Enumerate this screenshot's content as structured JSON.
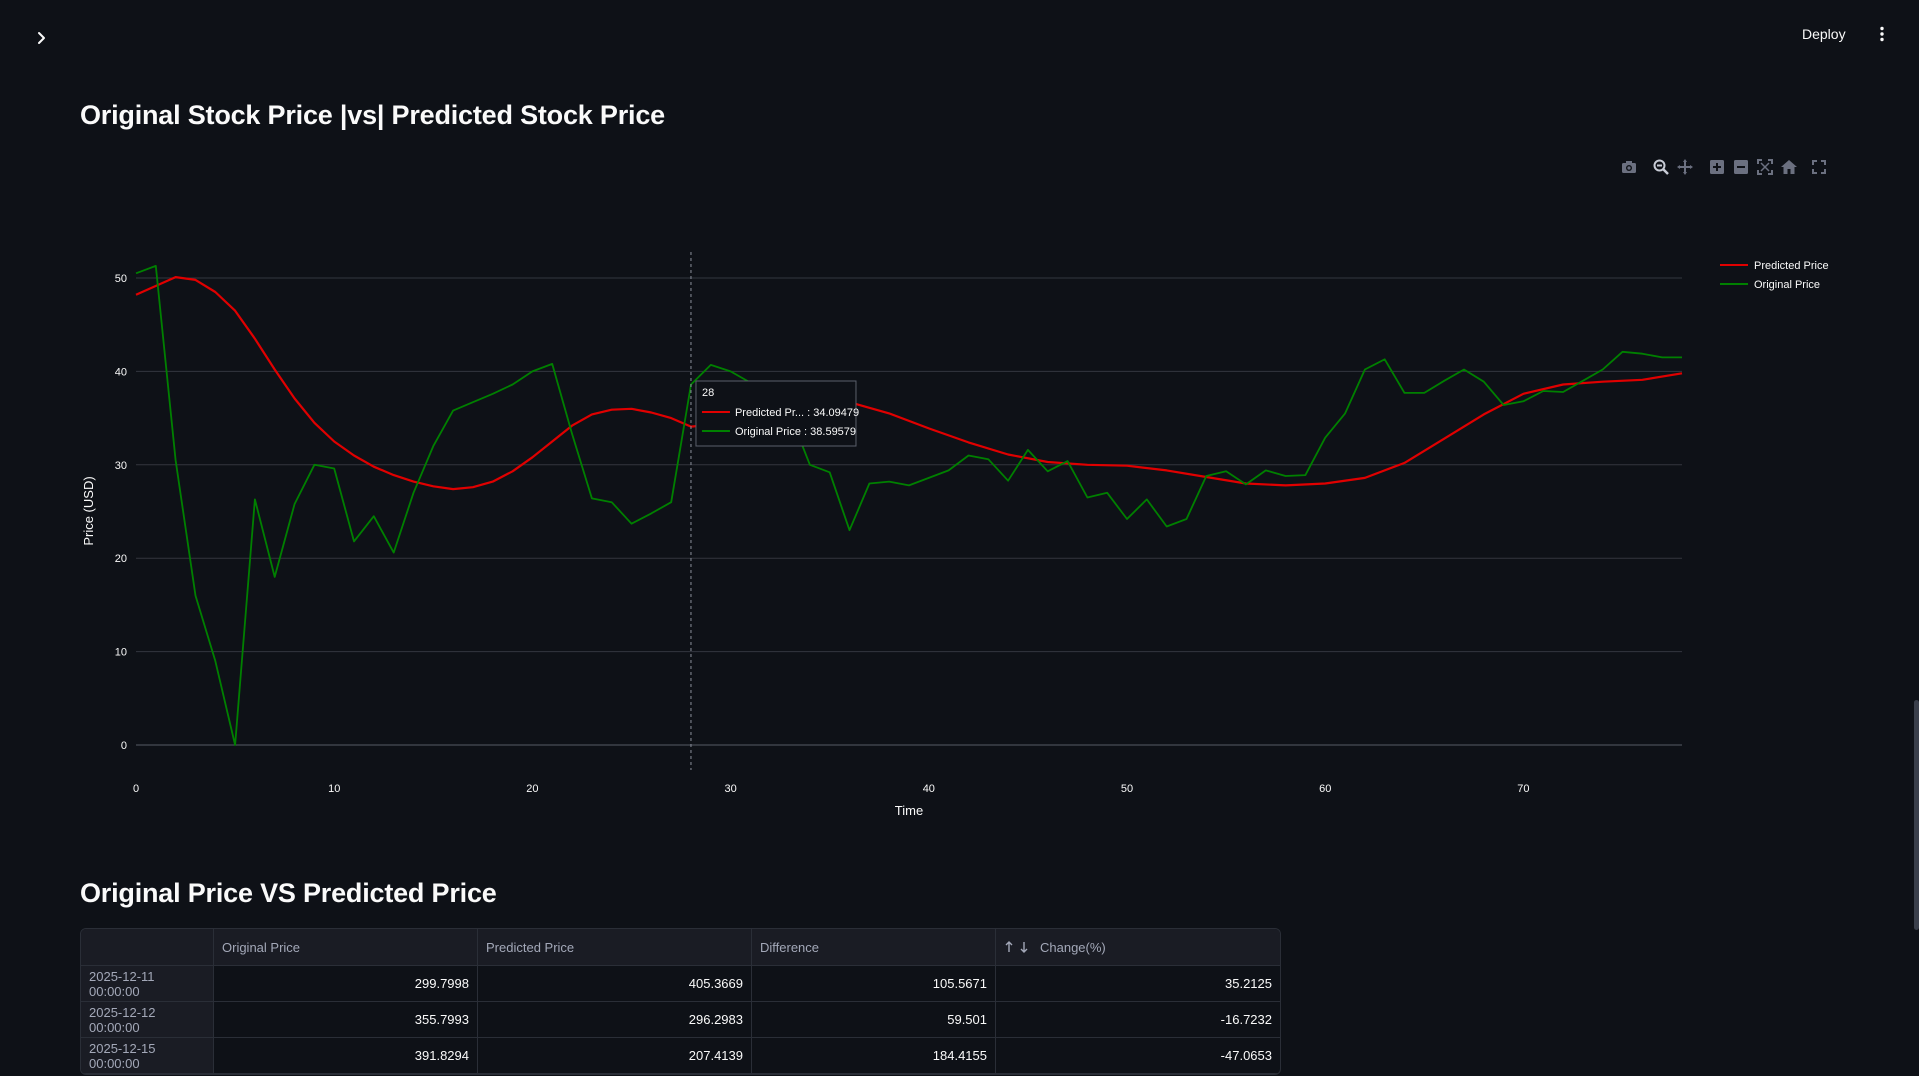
{
  "topbar": {
    "deploy_label": "Deploy",
    "menu_icon": "vertical-dots-icon",
    "sidebar_icon": "chevron-right-icon"
  },
  "headings": {
    "chart_title": "Original Stock Price |vs| Predicted Stock Price",
    "table_title": "Original Price VS Predicted Price"
  },
  "modebar": [
    "camera-icon",
    "zoom-icon",
    "pan-icon",
    "zoom-in-icon",
    "zoom-out-icon",
    "autoscale-icon",
    "reset-axes-icon",
    "fullscreen-icon"
  ],
  "chart_data": {
    "type": "line",
    "xlabel": "Time",
    "ylabel": "Price (USD)",
    "xlim": [
      0,
      78
    ],
    "ylim": [
      0,
      53
    ],
    "xticks": [
      0,
      10,
      20,
      30,
      40,
      50,
      60,
      70
    ],
    "yticks": [
      0,
      10,
      20,
      30,
      40,
      50
    ],
    "grid": true,
    "legend_position": "top-right",
    "series": [
      {
        "name": "Predicted Price",
        "color": "#e00000",
        "x": [
          0,
          2,
          3,
          4,
          5,
          6,
          7,
          8,
          9,
          10,
          11,
          12,
          13,
          14,
          15,
          16,
          17,
          18,
          19,
          20,
          21,
          22,
          23,
          24,
          25,
          26,
          27,
          28,
          30,
          32,
          34,
          36,
          38,
          40,
          42,
          44,
          46,
          48,
          50,
          52,
          54,
          56,
          58,
          60,
          62,
          64,
          66,
          68,
          70,
          72,
          74,
          76,
          78
        ],
        "y": [
          48.2,
          50.1,
          49.8,
          48.5,
          46.5,
          43.5,
          40.2,
          37.1,
          34.5,
          32.5,
          31.0,
          29.8,
          28.9,
          28.2,
          27.7,
          27.4,
          27.6,
          28.2,
          29.3,
          30.8,
          32.5,
          34.2,
          35.4,
          35.9,
          36.0,
          35.6,
          35.0,
          34.09,
          34.5,
          35.9,
          36.9,
          36.7,
          35.5,
          33.9,
          32.4,
          31.1,
          30.3,
          30.0,
          29.9,
          29.4,
          28.7,
          28.0,
          27.8,
          28.0,
          28.6,
          30.2,
          32.8,
          35.4,
          37.6,
          38.6,
          38.9,
          39.1,
          39.8
        ]
      },
      {
        "name": "Original Price",
        "color": "#008000",
        "x": [
          0,
          1,
          2,
          3,
          4,
          5,
          6,
          7,
          8,
          9,
          10,
          11,
          12,
          13,
          14,
          15,
          16,
          17,
          18,
          19,
          20,
          21,
          22,
          23,
          24,
          25,
          26,
          27,
          28,
          29,
          30,
          31,
          32,
          33,
          34,
          35,
          36,
          37,
          38,
          39,
          40,
          41,
          42,
          43,
          44,
          45,
          46,
          47,
          48,
          49,
          50,
          51,
          52,
          53,
          54,
          55,
          56,
          57,
          58,
          59,
          60,
          61,
          62,
          63,
          64,
          65,
          66,
          67,
          68,
          69,
          70,
          71,
          72,
          73,
          74,
          75,
          76,
          77,
          78
        ],
        "y": [
          50.5,
          51.3,
          30.5,
          16.0,
          9.0,
          0.0,
          26.3,
          18.0,
          25.8,
          30.0,
          29.6,
          21.8,
          24.5,
          20.6,
          27.0,
          32.0,
          35.8,
          36.7,
          37.6,
          38.6,
          40.0,
          40.8,
          33.3,
          26.4,
          26.0,
          23.7,
          24.8,
          26.0,
          38.6,
          40.7,
          40.0,
          38.8,
          37.2,
          35.4,
          30.0,
          29.2,
          23.0,
          28.0,
          28.2,
          27.8,
          28.6,
          29.4,
          31.0,
          30.6,
          28.3,
          31.6,
          29.3,
          30.4,
          26.5,
          27.0,
          24.2,
          26.3,
          23.4,
          24.2,
          28.8,
          29.3,
          27.9,
          29.4,
          28.8,
          28.9,
          32.9,
          35.5,
          40.2,
          41.3,
          37.7,
          37.7,
          39.0,
          40.2,
          38.9,
          36.4,
          36.8,
          37.9,
          37.8,
          39.0,
          40.2,
          42.1,
          41.9,
          41.5,
          41.5
        ]
      }
    ],
    "hover": {
      "x_label": "28",
      "items": [
        {
          "label": "Predicted Pr... : 34.09479",
          "color": "#e00000"
        },
        {
          "label": "Original Price : 38.59579",
          "color": "#008000"
        }
      ]
    }
  },
  "table": {
    "columns": [
      "",
      "Original Price",
      "Predicted Price",
      "Difference",
      "Change(%)"
    ],
    "sort_icons": "sort-arrows-icon",
    "rows": [
      [
        "2025-12-11 00:00:00",
        "299.7998",
        "405.3669",
        "105.5671",
        "35.2125"
      ],
      [
        "2025-12-12 00:00:00",
        "355.7993",
        "296.2983",
        "59.501",
        "-16.7232"
      ],
      [
        "2025-12-15 00:00:00",
        "391.8294",
        "207.4139",
        "184.4155",
        "-47.0653"
      ]
    ]
  }
}
